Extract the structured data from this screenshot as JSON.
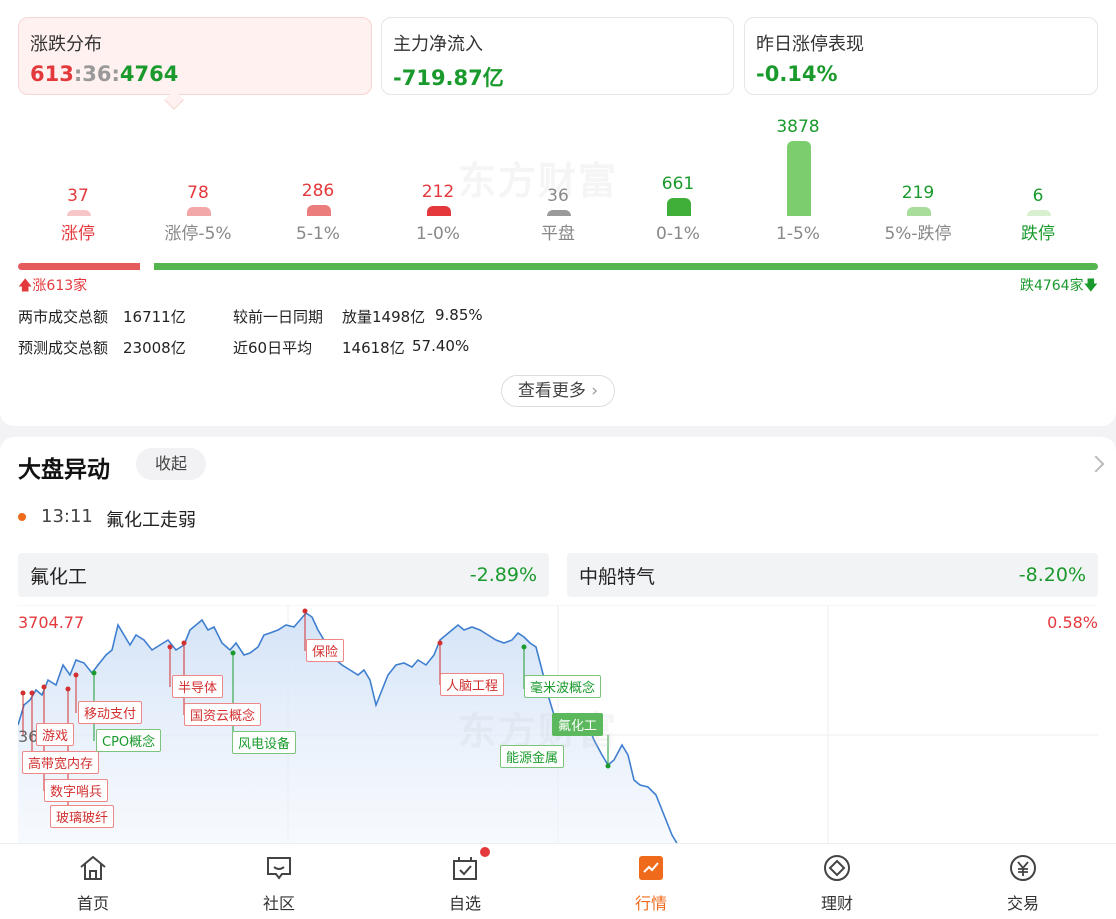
{
  "summary_cards": [
    {
      "label": "涨跌分布",
      "up": "613",
      "sep1": ":",
      "flat": "36",
      "sep2": ":",
      "down": "4764"
    },
    {
      "label": "主力净流入",
      "value": "-719.87亿"
    },
    {
      "label": "昨日涨停表现",
      "value": "-0.14%"
    }
  ],
  "watermark": "东方财富",
  "distribution": [
    {
      "count": "37",
      "label": "涨停",
      "count_color": "#e4393c",
      "bar_color": "#f7c7c7",
      "label_color": "#e4393c",
      "bar": 6
    },
    {
      "count": "78",
      "label": "涨停-5%",
      "count_color": "#e4393c",
      "bar_color": "#f2a8a8",
      "label_color": "#888",
      "bar": 9
    },
    {
      "count": "286",
      "label": "5-1%",
      "count_color": "#e4393c",
      "bar_color": "#eb7d7d",
      "label_color": "#888",
      "bar": 11
    },
    {
      "count": "212",
      "label": "1-0%",
      "count_color": "#e4393c",
      "bar_color": "#e4393c",
      "label_color": "#888",
      "bar": 10
    },
    {
      "count": "36",
      "label": "平盘",
      "count_color": "#888",
      "bar_color": "#9a9a9a",
      "label_color": "#888",
      "bar": 6
    },
    {
      "count": "661",
      "label": "0-1%",
      "count_color": "#1a9a2c",
      "bar_color": "#3faf3a",
      "label_color": "#888",
      "bar": 18
    },
    {
      "count": "3878",
      "label": "1-5%",
      "count_color": "#1a9a2c",
      "bar_color": "#7ccd6e",
      "label_color": "#888",
      "bar": 75
    },
    {
      "count": "219",
      "label": "5%-跌停",
      "count_color": "#1a9a2c",
      "bar_color": "#a9dd9b",
      "label_color": "#888",
      "bar": 9
    },
    {
      "count": "6",
      "label": "跌停",
      "count_color": "#1a9a2c",
      "bar_color": "#d8efd0",
      "label_color": "#1a9a2c",
      "bar": 6
    }
  ],
  "ratio": {
    "up_fraction": 0.113,
    "rise_label": "涨613家",
    "fall_label": "跌4764家"
  },
  "volume": {
    "total_label": "两市成交总额",
    "total_value": "16711亿",
    "compare_label": "较前一日同期",
    "compare_value": "放量1498亿",
    "compare_pct": "9.85%",
    "forecast_label": "预测成交总额",
    "forecast_value": "23008亿",
    "avg60_label": "近60日平均",
    "avg60_value": "14618亿",
    "avg60_pct": "57.40%"
  },
  "more_button": "查看更多",
  "movers": {
    "title": "大盘异动",
    "collapse": "收起",
    "event_time": "13:11",
    "event_text": "氟化工走弱",
    "sectors": [
      {
        "name": "氟化工",
        "pct": "-2.89%"
      },
      {
        "name": "中船特气",
        "pct": "-8.20%"
      }
    ]
  },
  "chart_data": {
    "type": "line",
    "y_left_top": "3704.77",
    "y_left_mid": "36",
    "y_right_top": "0.58%",
    "annotations": [
      {
        "text": "游戏",
        "kind": "up"
      },
      {
        "text": "高带宽内存",
        "kind": "up"
      },
      {
        "text": "数字哨兵",
        "kind": "up"
      },
      {
        "text": "玻璃玻纤",
        "kind": "up"
      },
      {
        "text": "移动支付",
        "kind": "up"
      },
      {
        "text": "CPO概念",
        "kind": "down"
      },
      {
        "text": "半导体",
        "kind": "up"
      },
      {
        "text": "国资云概念",
        "kind": "up"
      },
      {
        "text": "风电设备",
        "kind": "down"
      },
      {
        "text": "保险",
        "kind": "up"
      },
      {
        "text": "人脑工程",
        "kind": "up"
      },
      {
        "text": "毫米波概念",
        "kind": "down"
      },
      {
        "text": "氟化工",
        "kind": "hl"
      },
      {
        "text": "能源金属",
        "kind": "down"
      }
    ]
  },
  "tabs": [
    {
      "label": "首页",
      "icon": "home-icon"
    },
    {
      "label": "社区",
      "icon": "community-icon"
    },
    {
      "label": "自选",
      "icon": "watchlist-icon"
    },
    {
      "label": "行情",
      "icon": "market-icon"
    },
    {
      "label": "理财",
      "icon": "wealth-icon"
    },
    {
      "label": "交易",
      "icon": "trade-icon"
    }
  ]
}
